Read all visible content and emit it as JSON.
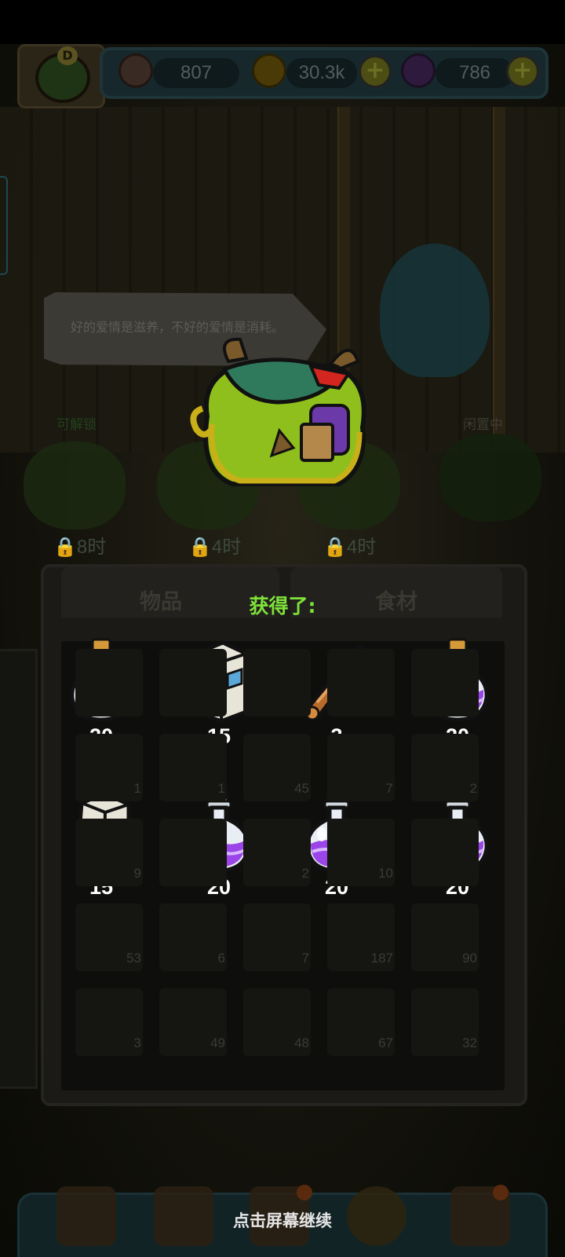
{
  "resources": {
    "eyes": "807",
    "coins": "30.3k",
    "potions": "786",
    "avatar_badge": "D"
  },
  "speech_bubble": "好的爱情是滋养，不好的爱情是消耗。",
  "slots": [
    {
      "status": "可解锁",
      "timer": "8时"
    },
    {
      "status": "",
      "timer": "4时"
    },
    {
      "status": "",
      "timer": "4时"
    },
    {
      "status": "闲置中",
      "timer": ""
    }
  ],
  "inventory": {
    "tabs": [
      "物品",
      "食材"
    ],
    "background_counts": [
      "1",
      "1",
      "45",
      "7",
      "2",
      "9",
      "2",
      "10",
      "53",
      "6",
      "7",
      "187",
      "90",
      "3",
      "49",
      "48",
      "67",
      "32"
    ]
  },
  "reward": {
    "title": "获得了:",
    "items": [
      {
        "icon": "potion-icon",
        "qty": "20"
      },
      {
        "icon": "milk-carton-icon",
        "qty": "15"
      },
      {
        "icon": "cinnamon-stick-icon",
        "qty": "3"
      },
      {
        "icon": "potion-icon",
        "qty": "20"
      },
      {
        "icon": "milk-carton-icon",
        "qty": "15"
      },
      {
        "icon": "potion-icon",
        "qty": "20"
      },
      {
        "icon": "potion-icon",
        "qty": "20"
      },
      {
        "icon": "potion-icon",
        "qty": "20"
      }
    ]
  },
  "continue_hint": "点击屏幕继续",
  "colors": {
    "reward_title": "#7fe23a",
    "potion_liquid": "#9b45e8",
    "overlay": "#000000"
  }
}
